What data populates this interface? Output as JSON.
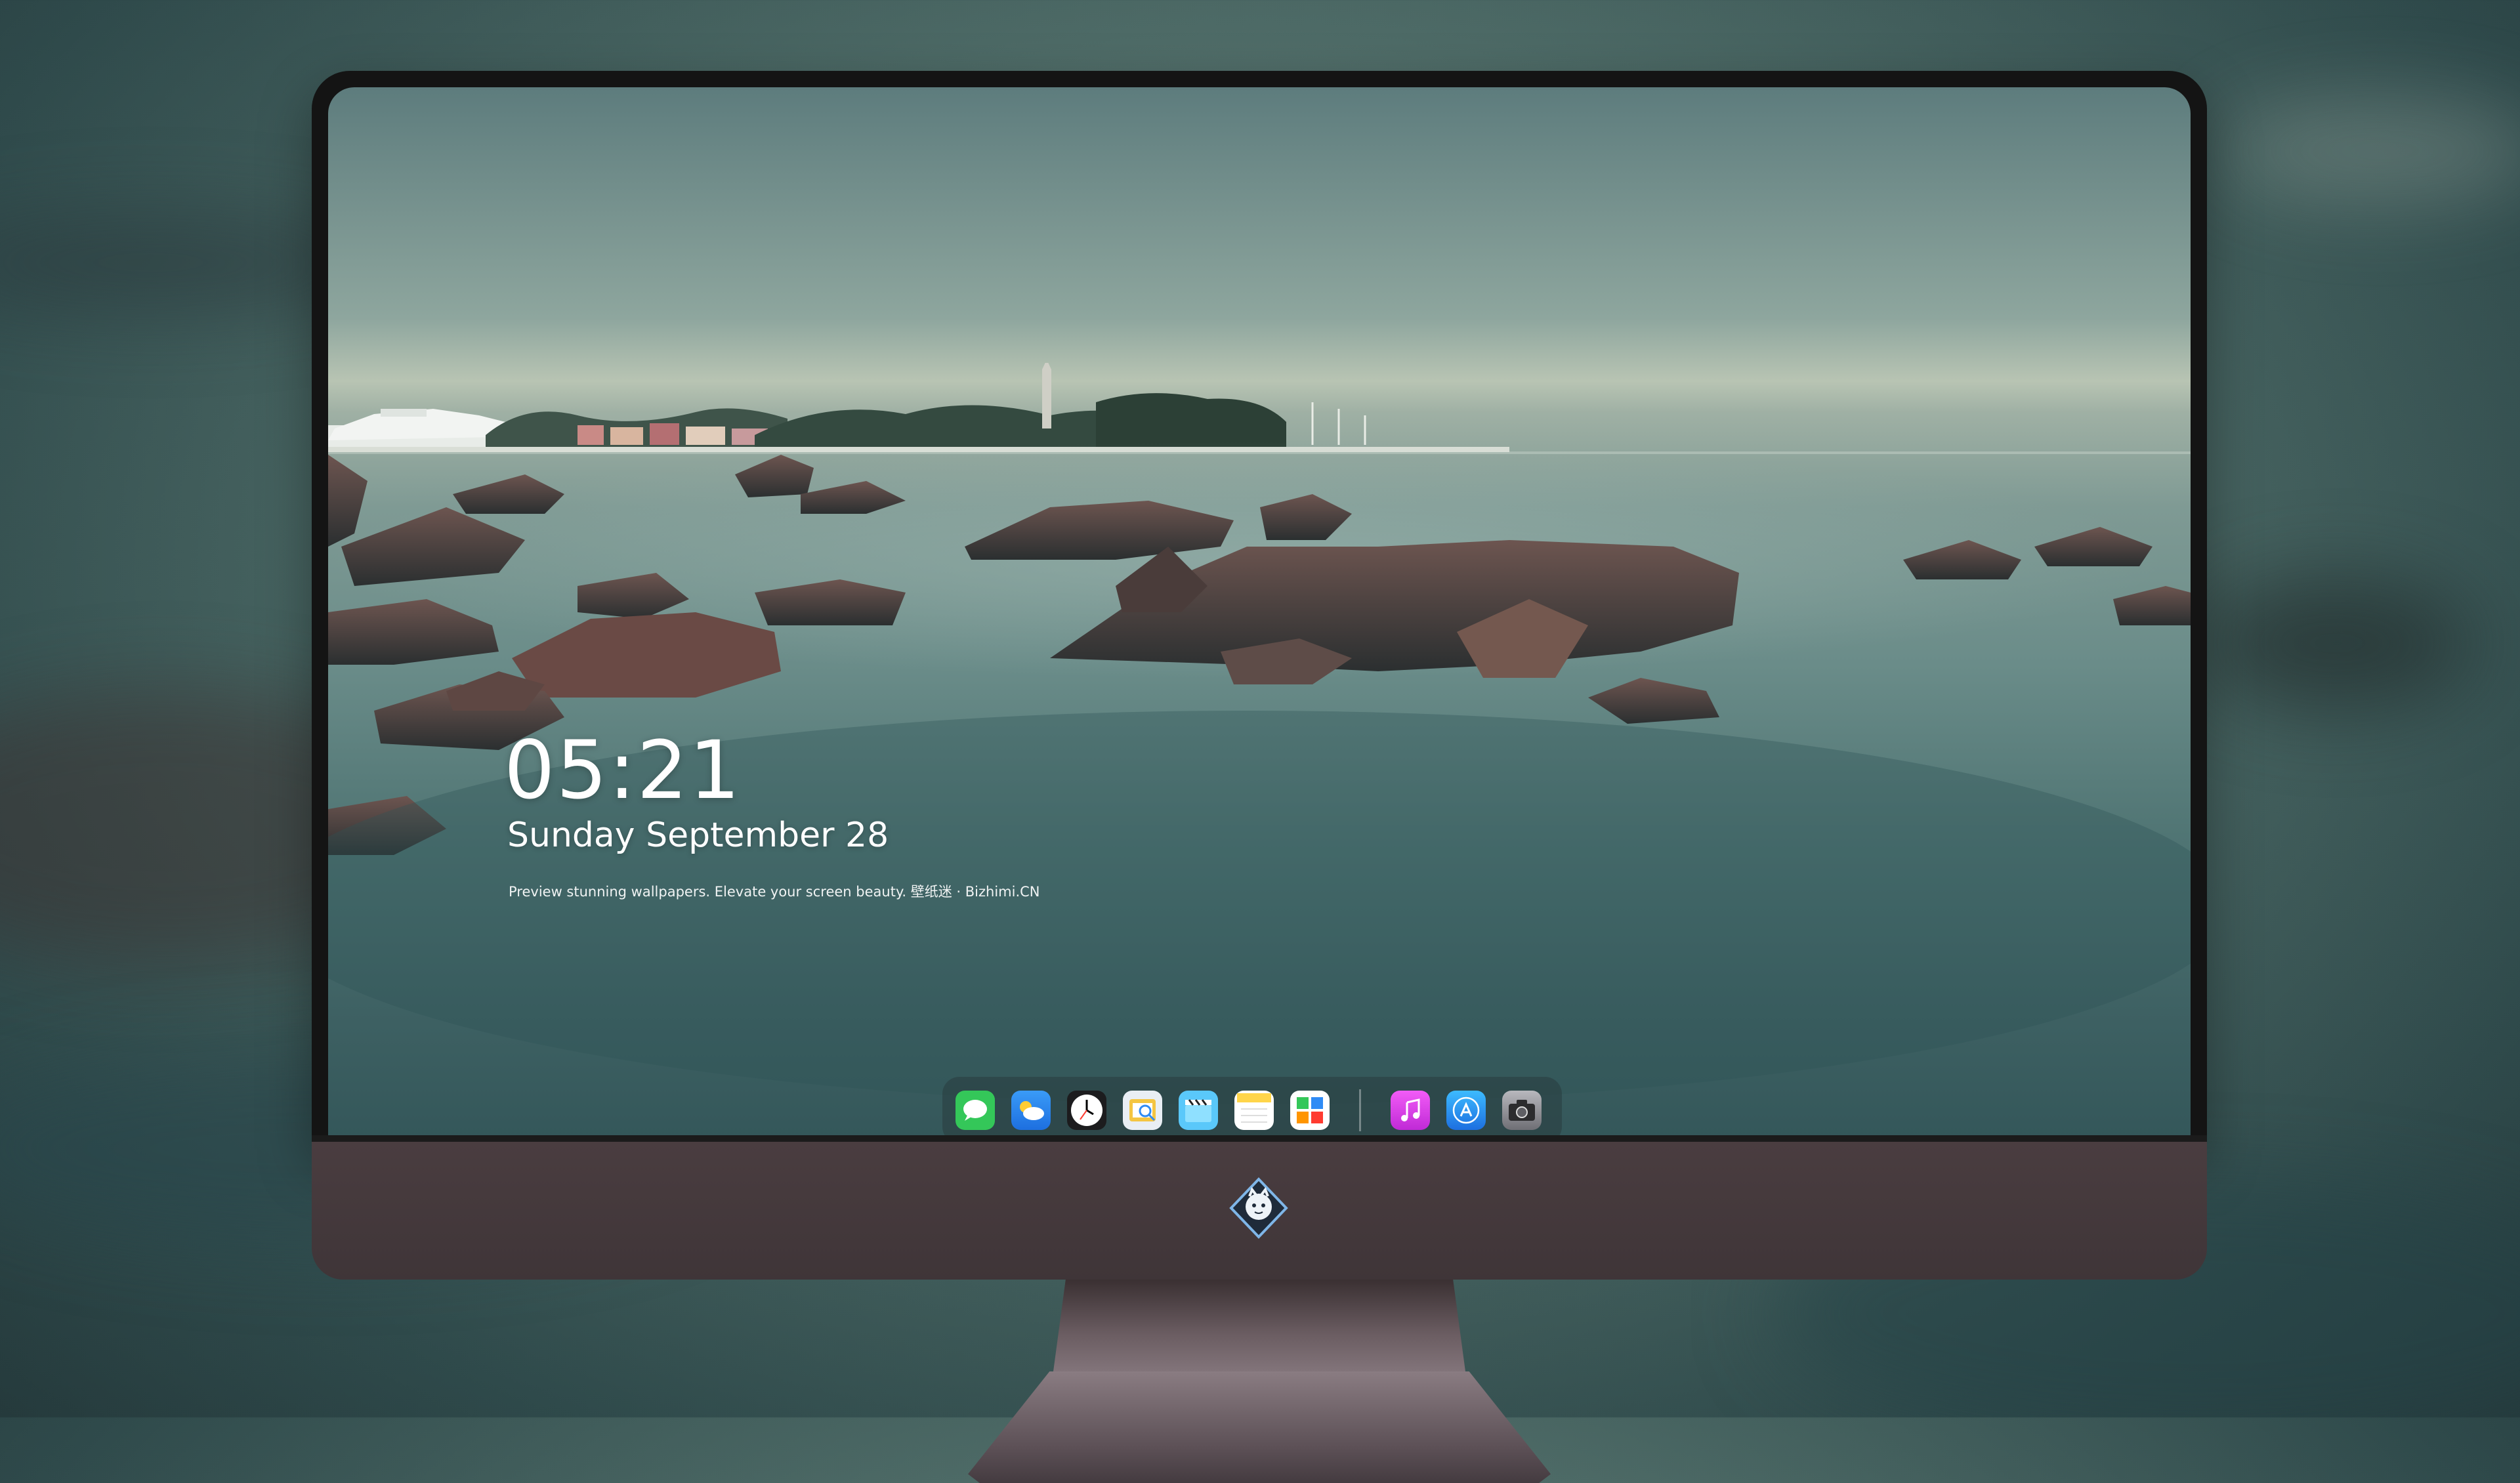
{
  "lockscreen": {
    "time": "05:21",
    "date": "Sunday September  28",
    "tagline": "Preview stunning wallpapers. Elevate your screen beauty. 壁纸迷 · Bizhimi.CN"
  },
  "dock": {
    "apps": [
      {
        "icon": "messages-icon",
        "color": "#34c759"
      },
      {
        "icon": "weather-icon",
        "color": "#2f8bf5"
      },
      {
        "icon": "clock-icon",
        "color": "#ffffff"
      },
      {
        "icon": "preview-icon",
        "color": "#f4c542"
      },
      {
        "icon": "clips-icon",
        "color": "#5ac8fa"
      },
      {
        "icon": "notes-icon",
        "color": "#ffd54a"
      },
      {
        "icon": "photos-icon",
        "color": "#ff9500"
      },
      {
        "icon": "music-icon",
        "color": "#e040fb"
      },
      {
        "icon": "app-store-icon",
        "color": "#1e90ff"
      },
      {
        "icon": "camera-icon",
        "color": "#8e8e93"
      }
    ]
  },
  "monitor": {
    "logo": "bizhimi-logo"
  }
}
